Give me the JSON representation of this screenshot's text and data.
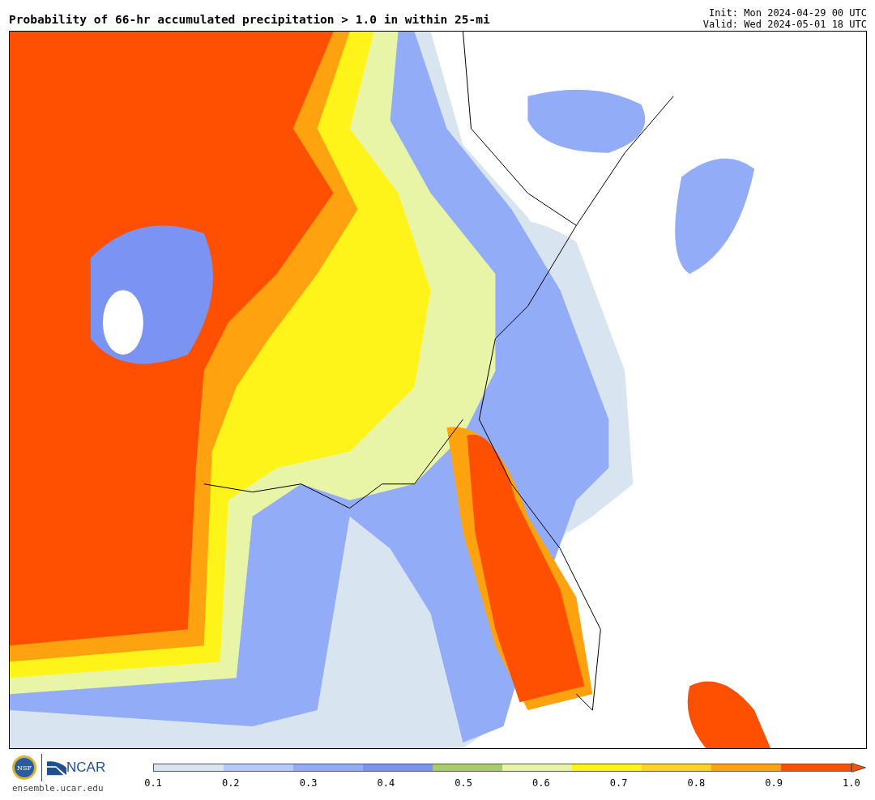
{
  "title": "Probability of 66-hr accumulated precipitation > 1.0 in within 25-mi",
  "init": "Init: Mon 2024-04-29 00 UTC",
  "valid": "Valid: Wed 2024-05-01 18 UTC",
  "logos": {
    "nsf": "NSF",
    "ncar": "NCAR",
    "site": "ensemble.ucar.edu"
  },
  "colorbar": {
    "segments": [
      {
        "color": "#d8e4ef"
      },
      {
        "color": "#b5c9fb"
      },
      {
        "color": "#92acf7"
      },
      {
        "color": "#7b93f2"
      },
      {
        "color": "#a8cc6a"
      },
      {
        "color": "#e8f5a6"
      },
      {
        "color": "#fff41a"
      },
      {
        "color": "#ffd226"
      },
      {
        "color": "#ffa20f"
      },
      {
        "color": "#ff4f00"
      }
    ],
    "ticks": [
      "0.1",
      "0.2",
      "0.3",
      "0.4",
      "0.5",
      "0.6",
      "0.7",
      "0.8",
      "0.9",
      "1.0"
    ]
  }
}
